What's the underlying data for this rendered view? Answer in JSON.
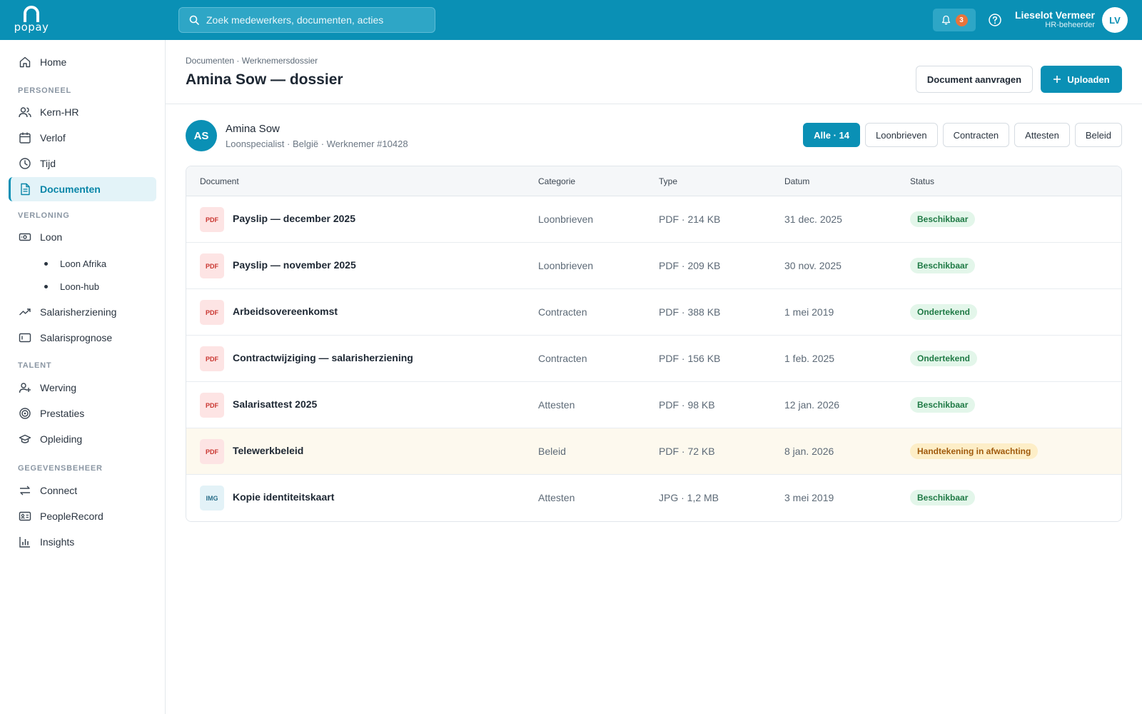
{
  "app": {
    "logo_text": "popay"
  },
  "search": {
    "placeholder": "Zoek medewerkers, documenten, acties"
  },
  "notifications": {
    "count": "3"
  },
  "user": {
    "name": "Lieselot Vermeer",
    "role": "HR-beheerder",
    "initials": "LV"
  },
  "sidebar": {
    "home": "Home",
    "sections": {
      "personeel": "PERSONEEL",
      "verloning": "VERLONING",
      "talent": "TALENT",
      "gegevensbeheer": "GEGEVENSBEHEER"
    },
    "items": {
      "kern_hr": "Kern-HR",
      "verlof": "Verlof",
      "tijd": "Tijd",
      "documenten": "Documenten",
      "loon": "Loon",
      "loon_afrika": "Loon Afrika",
      "loon_hub": "Loon-hub",
      "salarisherziening": "Salarisherziening",
      "salarisprognose": "Salarisprognose",
      "werving": "Werving",
      "prestaties": "Prestaties",
      "opleiding": "Opleiding",
      "connect": "Connect",
      "peoplerecord": "PeopleRecord",
      "insights": "Insights"
    }
  },
  "header": {
    "breadcrumb": "Documenten · Werknemersdossier",
    "title": "Amina Sow — dossier",
    "request_label": "Document aanvragen",
    "upload_label": "Uploaden"
  },
  "employee": {
    "initials": "AS",
    "name": "Amina Sow",
    "meta": "Loonspecialist · België · Werknemer #10428"
  },
  "filters": [
    "Alle · 14",
    "Loonbrieven",
    "Contracten",
    "Attesten",
    "Beleid"
  ],
  "table": {
    "headers": {
      "document": "Document",
      "categorie": "Categorie",
      "type": "Type",
      "datum": "Datum",
      "status": "Status"
    },
    "rows": [
      {
        "icon": "PDF",
        "name": "Payslip — december 2025",
        "categorie": "Loonbrieven",
        "type": "PDF · 214 KB",
        "datum": "31 dec. 2025",
        "status": "Beschikbaar"
      },
      {
        "icon": "PDF",
        "name": "Payslip — november 2025",
        "categorie": "Loonbrieven",
        "type": "PDF · 209 KB",
        "datum": "30 nov. 2025",
        "status": "Beschikbaar"
      },
      {
        "icon": "PDF",
        "name": "Arbeidsovereenkomst",
        "categorie": "Contracten",
        "type": "PDF · 388 KB",
        "datum": "1 mei 2019",
        "status": "Ondertekend"
      },
      {
        "icon": "PDF",
        "name": "Contractwijziging — salarisherziening",
        "categorie": "Contracten",
        "type": "PDF · 156 KB",
        "datum": "1 feb. 2025",
        "status": "Ondertekend"
      },
      {
        "icon": "PDF",
        "name": "Salarisattest 2025",
        "categorie": "Attesten",
        "type": "PDF · 98 KB",
        "datum": "12 jan. 2026",
        "status": "Beschikbaar"
      },
      {
        "icon": "PDF",
        "name": "Telewerkbeleid",
        "categorie": "Beleid",
        "type": "PDF · 72 KB",
        "datum": "8 jan. 2026",
        "status": "Handtekening in afwachting"
      },
      {
        "icon": "IMG",
        "name": "Kopie identiteitskaart",
        "categorie": "Attesten",
        "type": "JPG · 1,2 MB",
        "datum": "3 mei 2019",
        "status": "Beschikbaar"
      }
    ]
  },
  "colors": {
    "brand": "#0a90b5",
    "status_green": "#1f7a45",
    "status_amber": "#a05a0c",
    "notification": "#e8743b"
  }
}
